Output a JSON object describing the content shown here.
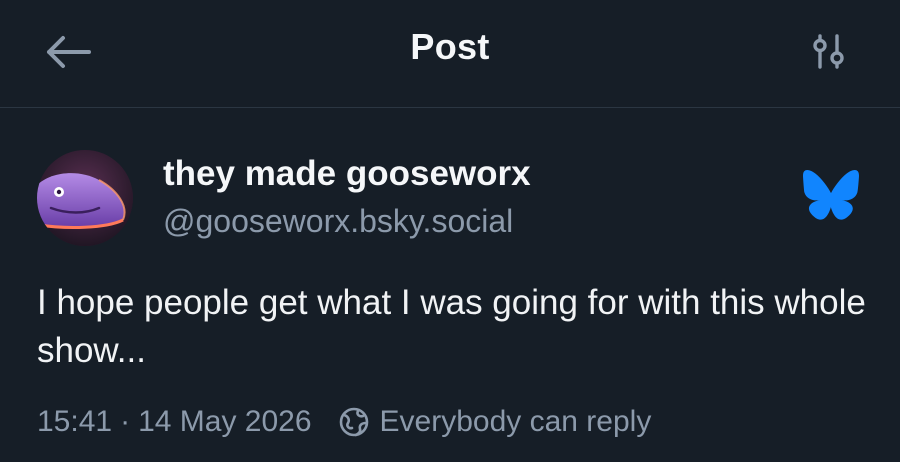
{
  "header": {
    "title": "Post",
    "back_icon": "arrow-left-icon",
    "settings_icon": "sliders-icon"
  },
  "post": {
    "author": {
      "display_name": "they made gooseworx",
      "handle": "@gooseworx.bsky.social",
      "avatar": "avatar-purple-creature"
    },
    "text": "I hope people get what I was going for with this whole show...",
    "time": "15:41",
    "separator": "·",
    "date": "14 May 2026",
    "reply_setting_icon": "globe-icon",
    "reply_setting": "Everybody can reply"
  },
  "colors": {
    "background": "#161e27",
    "divider": "#2b3642",
    "text_primary": "#f1f3f5",
    "text_secondary": "#8c9aab",
    "bluesky_blue": "#1185fe"
  },
  "brand_icon": "bluesky-butterfly-icon"
}
